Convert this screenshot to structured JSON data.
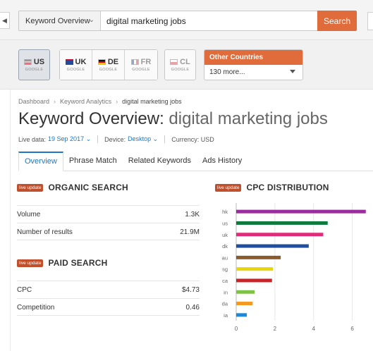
{
  "search": {
    "database_select": "Keyword Overview",
    "query": "digital marketing jobs",
    "button": "Search"
  },
  "countries": [
    {
      "code": "US",
      "sub": "GOOGLE",
      "active": true
    },
    {
      "code": "UK",
      "sub": "GOOGLE"
    },
    {
      "code": "DE",
      "sub": "GOOGLE"
    },
    {
      "code": "FR",
      "sub": "GOOGLE",
      "dim": true
    },
    {
      "code": "CL",
      "sub": "GOOGLE",
      "dim": true
    }
  ],
  "other_countries": {
    "label": "Other Countries",
    "selected": "130 more..."
  },
  "breadcrumb": [
    "Dashboard",
    "Keyword Analytics",
    "digital marketing jobs"
  ],
  "title": {
    "prefix": "Keyword Overview:",
    "query": "digital marketing jobs"
  },
  "meta": {
    "live_label": "Live data:",
    "live_value": "19 Sep 2017",
    "device_label": "Device:",
    "device_value": "Desktop",
    "currency": "Currency: USD"
  },
  "tabs": [
    "Overview",
    "Phrase Match",
    "Related Keywords",
    "Ads History"
  ],
  "organic": {
    "badge": "live update",
    "title": "ORGANIC SEARCH",
    "rows": [
      {
        "label": "Volume",
        "value": "1.3K"
      },
      {
        "label": "Number of results",
        "value": "21.9M"
      }
    ]
  },
  "paid": {
    "badge": "live update",
    "title": "PAID SEARCH",
    "rows": [
      {
        "label": "CPC",
        "value": "$4.73"
      },
      {
        "label": "Competition",
        "value": "0.46"
      }
    ]
  },
  "cpc": {
    "badge": "live update",
    "title": "CPC DISTRIBUTION"
  },
  "chart_data": {
    "type": "bar",
    "orientation": "horizontal",
    "title": "CPC DISTRIBUTION",
    "categories": [
      "hk",
      "us",
      "uk",
      "dk",
      "au",
      "sg",
      "ca",
      "in",
      "da",
      "ia"
    ],
    "values": [
      6.7,
      4.73,
      4.5,
      3.75,
      2.3,
      1.9,
      1.85,
      0.95,
      0.85,
      0.55
    ],
    "colors": [
      "#9b2c9e",
      "#0f7a3e",
      "#df2b79",
      "#1f4e9c",
      "#8a5a2a",
      "#e7d512",
      "#c9232a",
      "#7dc242",
      "#f39a1e",
      "#1e88d8"
    ],
    "xlim": [
      0,
      7
    ],
    "xticks": [
      0,
      2,
      4,
      6
    ],
    "grid": true
  }
}
